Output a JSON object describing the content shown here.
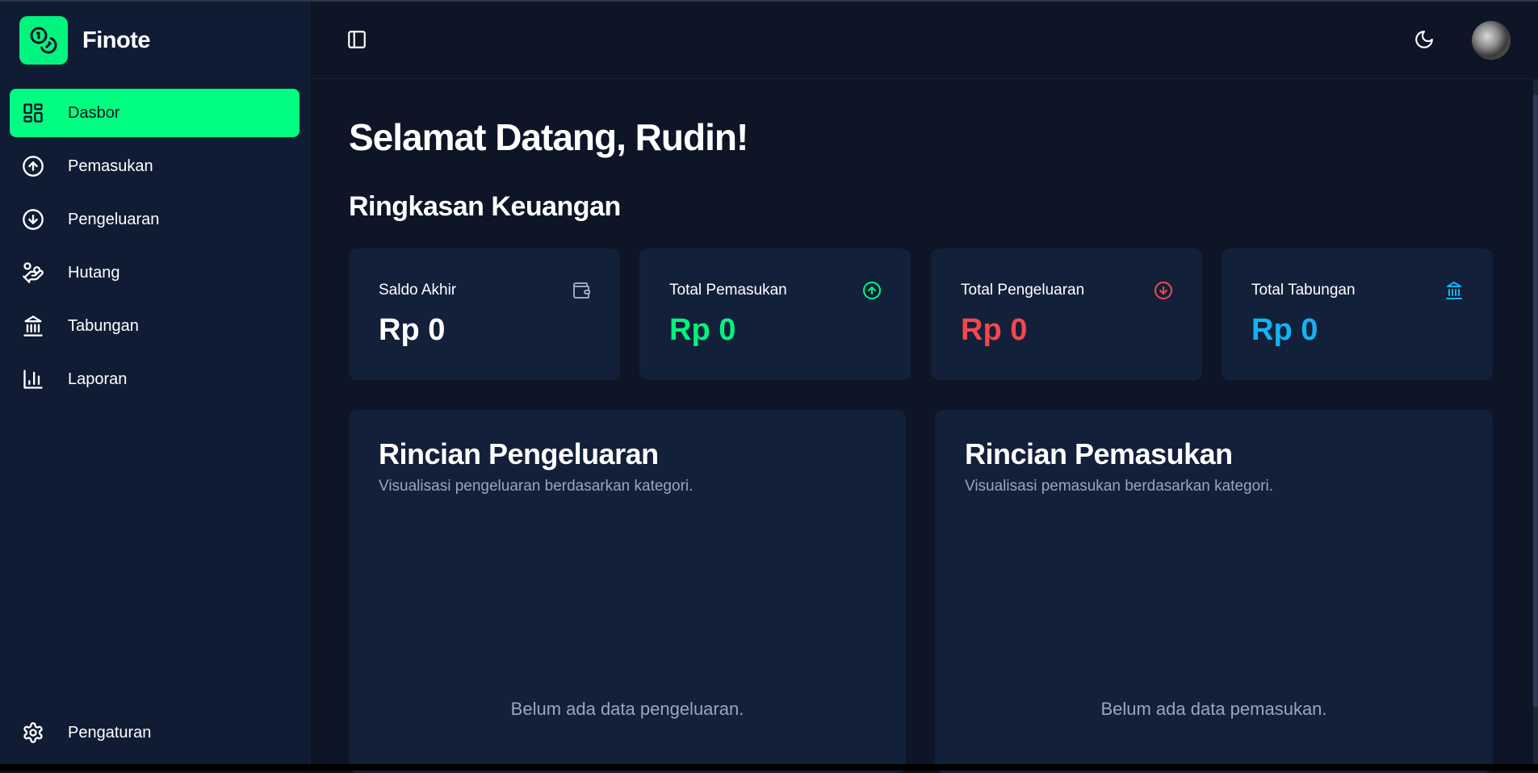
{
  "brand": {
    "name": "Finote",
    "accent": "#00ff80"
  },
  "sidebar": {
    "items": [
      {
        "label": "Dasbor",
        "icon": "dashboard-icon",
        "active": true
      },
      {
        "label": "Pemasukan",
        "icon": "arrow-up-circle-icon"
      },
      {
        "label": "Pengeluaran",
        "icon": "arrow-down-circle-icon"
      },
      {
        "label": "Hutang",
        "icon": "hand-coins-icon"
      },
      {
        "label": "Tabungan",
        "icon": "bank-icon"
      },
      {
        "label": "Laporan",
        "icon": "bar-chart-icon"
      }
    ],
    "bottom": {
      "label": "Pengaturan",
      "icon": "gear-icon"
    }
  },
  "header": {
    "toggle_icon": "sidebar-toggle-icon",
    "theme_icon": "moon-icon",
    "avatar": "user-avatar"
  },
  "main": {
    "welcome": "Selamat Datang, Rudin!",
    "summary_title": "Ringkasan Keuangan",
    "cards": [
      {
        "label": "Saldo Akhir",
        "value": "Rp 0",
        "color": "#ffffff",
        "icon": "wallet-icon"
      },
      {
        "label": "Total Pemasukan",
        "value": "Rp 0",
        "color": "#00f57f",
        "icon": "arrow-up-circle-icon"
      },
      {
        "label": "Total Pengeluaran",
        "value": "Rp 0",
        "color": "#f5474d",
        "icon": "arrow-down-circle-icon"
      },
      {
        "label": "Total Tabungan",
        "value": "Rp 0",
        "color": "#12b3f5",
        "icon": "bank-icon"
      }
    ],
    "panels": [
      {
        "title": "Rincian Pengeluaran",
        "subtitle": "Visualisasi pengeluaran berdasarkan kategori.",
        "empty": "Belum ada data pengeluaran."
      },
      {
        "title": "Rincian Pemasukan",
        "subtitle": "Visualisasi pemasukan berdasarkan kategori.",
        "empty": "Belum ada data pemasukan."
      }
    ]
  }
}
